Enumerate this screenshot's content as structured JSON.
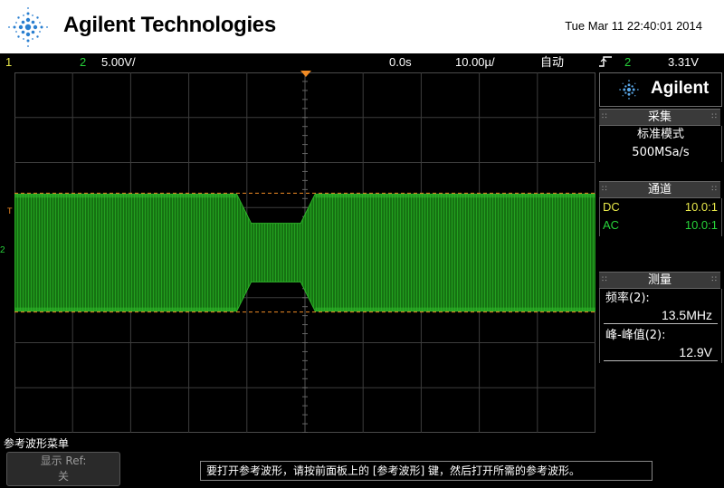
{
  "header": {
    "brand": "Agilent Technologies",
    "datetime": "Tue Mar 11 22:40:01 2014"
  },
  "statusbar": {
    "ch1_label": "1",
    "ch2_label": "2",
    "ch2_scale": "5.00V/",
    "time_position": "0.0s",
    "time_per_div": "10.00µ/",
    "acquisition_mode": "自动",
    "trigger_source": "2",
    "trigger_level": "3.31V"
  },
  "screen_markers": {
    "trigger_marker": "T",
    "ch2_marker": "2"
  },
  "panel": {
    "logo_text": "Agilent",
    "acquire": {
      "heading": "采集",
      "mode": "标准模式",
      "sample_rate": "500MSa/s"
    },
    "channels": {
      "heading": "通道",
      "rows": [
        {
          "coupling": "DC",
          "probe": "10.0:1",
          "color": "#e8e84a"
        },
        {
          "coupling": "AC",
          "probe": "10.0:1",
          "color": "#27d23a"
        }
      ]
    },
    "measure": {
      "heading": "测量",
      "items": [
        {
          "label": "频率(2):",
          "value": "13.5MHz"
        },
        {
          "label": "峰-峰值(2):",
          "value": "12.9V"
        }
      ]
    }
  },
  "waveform": {
    "grid_divisions": {
      "x": 10,
      "y": 8
    },
    "trace_color": "#1f8c1a",
    "cursor_color": "#f08a24",
    "burst_envelope": {
      "full_amplitude_divisions": 2.6,
      "reduced_amplitude_divisions": 1.3,
      "reduced_segment_time_divisions": [
        3.95,
        5.05
      ]
    }
  },
  "bottom": {
    "menu_title": "参考波形菜单",
    "softkey_line1": "显示 Ref:",
    "softkey_line2": "关",
    "message": "要打开参考波形，请按前面板上的 [参考波形] 键，然后打开所需的参考波形。"
  },
  "colors": {
    "ch1": "#e8e84a",
    "ch2": "#27d23a",
    "trigger_marker": "#f08a24",
    "panel_header": "#3a3a3a"
  }
}
